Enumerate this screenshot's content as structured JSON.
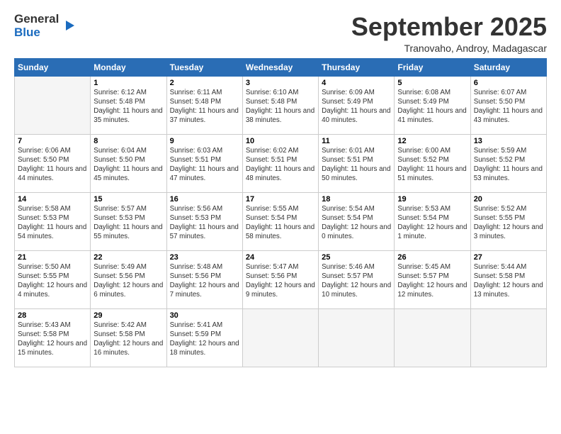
{
  "header": {
    "logo_general": "General",
    "logo_blue": "Blue",
    "month_title": "September 2025",
    "location": "Tranovaho, Androy, Madagascar"
  },
  "days_of_week": [
    "Sunday",
    "Monday",
    "Tuesday",
    "Wednesday",
    "Thursday",
    "Friday",
    "Saturday"
  ],
  "weeks": [
    [
      {
        "day": "",
        "empty": true
      },
      {
        "day": "1",
        "sunrise": "6:12 AM",
        "sunset": "5:48 PM",
        "daylight": "11 hours and 35 minutes."
      },
      {
        "day": "2",
        "sunrise": "6:11 AM",
        "sunset": "5:48 PM",
        "daylight": "11 hours and 37 minutes."
      },
      {
        "day": "3",
        "sunrise": "6:10 AM",
        "sunset": "5:48 PM",
        "daylight": "11 hours and 38 minutes."
      },
      {
        "day": "4",
        "sunrise": "6:09 AM",
        "sunset": "5:49 PM",
        "daylight": "11 hours and 40 minutes."
      },
      {
        "day": "5",
        "sunrise": "6:08 AM",
        "sunset": "5:49 PM",
        "daylight": "11 hours and 41 minutes."
      },
      {
        "day": "6",
        "sunrise": "6:07 AM",
        "sunset": "5:50 PM",
        "daylight": "11 hours and 43 minutes."
      }
    ],
    [
      {
        "day": "7",
        "sunrise": "6:06 AM",
        "sunset": "5:50 PM",
        "daylight": "11 hours and 44 minutes."
      },
      {
        "day": "8",
        "sunrise": "6:04 AM",
        "sunset": "5:50 PM",
        "daylight": "11 hours and 45 minutes."
      },
      {
        "day": "9",
        "sunrise": "6:03 AM",
        "sunset": "5:51 PM",
        "daylight": "11 hours and 47 minutes."
      },
      {
        "day": "10",
        "sunrise": "6:02 AM",
        "sunset": "5:51 PM",
        "daylight": "11 hours and 48 minutes."
      },
      {
        "day": "11",
        "sunrise": "6:01 AM",
        "sunset": "5:51 PM",
        "daylight": "11 hours and 50 minutes."
      },
      {
        "day": "12",
        "sunrise": "6:00 AM",
        "sunset": "5:52 PM",
        "daylight": "11 hours and 51 minutes."
      },
      {
        "day": "13",
        "sunrise": "5:59 AM",
        "sunset": "5:52 PM",
        "daylight": "11 hours and 53 minutes."
      }
    ],
    [
      {
        "day": "14",
        "sunrise": "5:58 AM",
        "sunset": "5:53 PM",
        "daylight": "11 hours and 54 minutes."
      },
      {
        "day": "15",
        "sunrise": "5:57 AM",
        "sunset": "5:53 PM",
        "daylight": "11 hours and 55 minutes."
      },
      {
        "day": "16",
        "sunrise": "5:56 AM",
        "sunset": "5:53 PM",
        "daylight": "11 hours and 57 minutes."
      },
      {
        "day": "17",
        "sunrise": "5:55 AM",
        "sunset": "5:54 PM",
        "daylight": "11 hours and 58 minutes."
      },
      {
        "day": "18",
        "sunrise": "5:54 AM",
        "sunset": "5:54 PM",
        "daylight": "12 hours and 0 minutes."
      },
      {
        "day": "19",
        "sunrise": "5:53 AM",
        "sunset": "5:54 PM",
        "daylight": "12 hours and 1 minute."
      },
      {
        "day": "20",
        "sunrise": "5:52 AM",
        "sunset": "5:55 PM",
        "daylight": "12 hours and 3 minutes."
      }
    ],
    [
      {
        "day": "21",
        "sunrise": "5:50 AM",
        "sunset": "5:55 PM",
        "daylight": "12 hours and 4 minutes."
      },
      {
        "day": "22",
        "sunrise": "5:49 AM",
        "sunset": "5:56 PM",
        "daylight": "12 hours and 6 minutes."
      },
      {
        "day": "23",
        "sunrise": "5:48 AM",
        "sunset": "5:56 PM",
        "daylight": "12 hours and 7 minutes."
      },
      {
        "day": "24",
        "sunrise": "5:47 AM",
        "sunset": "5:56 PM",
        "daylight": "12 hours and 9 minutes."
      },
      {
        "day": "25",
        "sunrise": "5:46 AM",
        "sunset": "5:57 PM",
        "daylight": "12 hours and 10 minutes."
      },
      {
        "day": "26",
        "sunrise": "5:45 AM",
        "sunset": "5:57 PM",
        "daylight": "12 hours and 12 minutes."
      },
      {
        "day": "27",
        "sunrise": "5:44 AM",
        "sunset": "5:58 PM",
        "daylight": "12 hours and 13 minutes."
      }
    ],
    [
      {
        "day": "28",
        "sunrise": "5:43 AM",
        "sunset": "5:58 PM",
        "daylight": "12 hours and 15 minutes."
      },
      {
        "day": "29",
        "sunrise": "5:42 AM",
        "sunset": "5:58 PM",
        "daylight": "12 hours and 16 minutes."
      },
      {
        "day": "30",
        "sunrise": "5:41 AM",
        "sunset": "5:59 PM",
        "daylight": "12 hours and 18 minutes."
      },
      {
        "day": "",
        "empty": true
      },
      {
        "day": "",
        "empty": true
      },
      {
        "day": "",
        "empty": true
      },
      {
        "day": "",
        "empty": true
      }
    ]
  ]
}
